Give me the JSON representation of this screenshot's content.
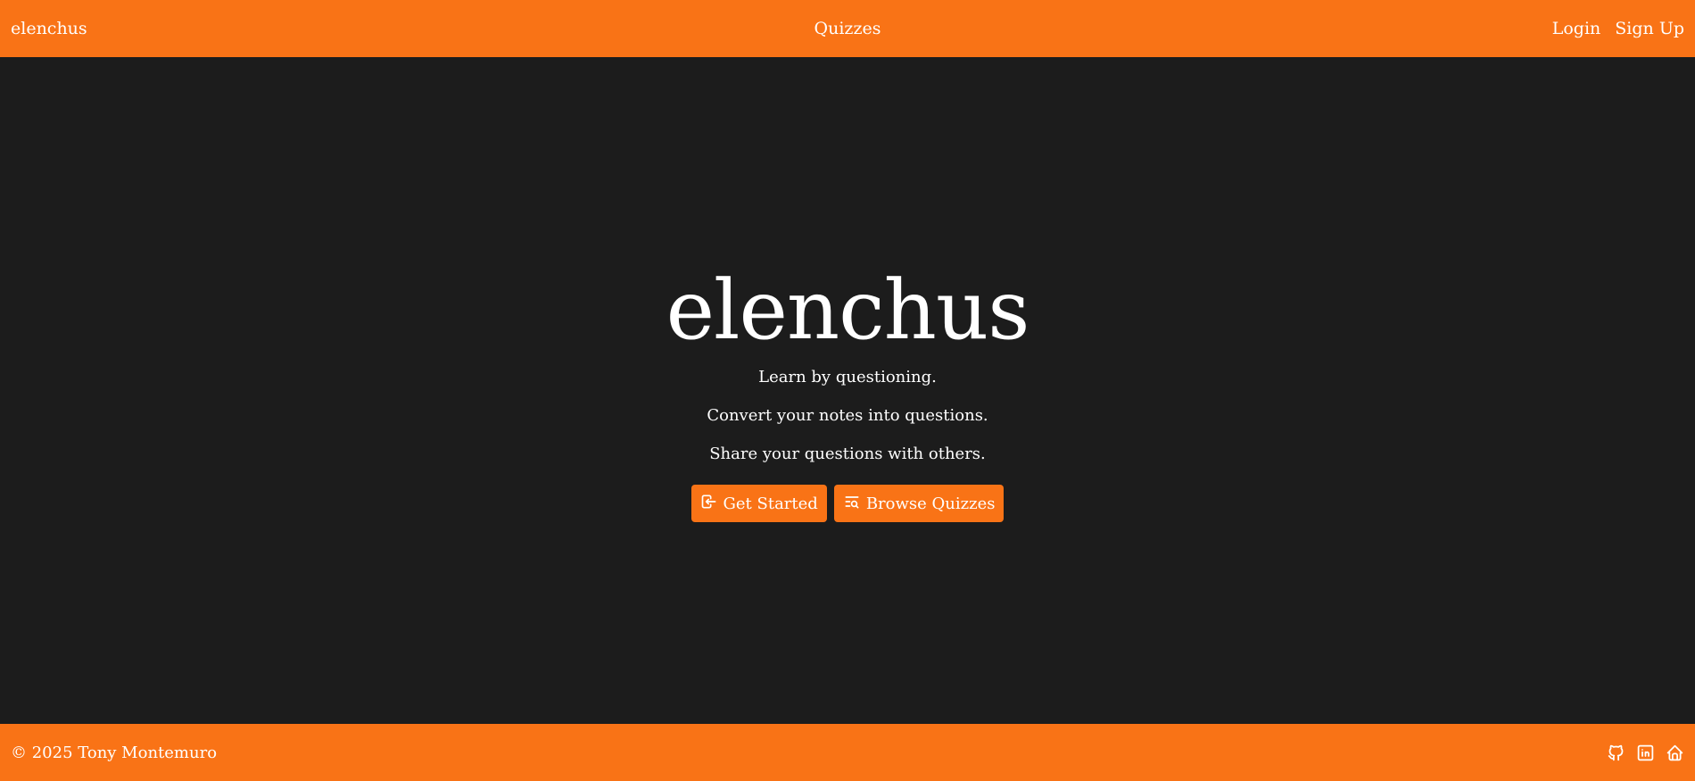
{
  "header": {
    "brand": "elenchus",
    "center_link": "Quizzes",
    "login": "Login",
    "signup": "Sign Up"
  },
  "hero": {
    "title": "elenchus",
    "tagline": "Learn by questioning.",
    "line1": "Convert your notes into questions.",
    "line2": "Share your questions with others."
  },
  "actions": {
    "get_started": {
      "label": "Get Started",
      "icon": "login-icon"
    },
    "browse": {
      "label": "Browse Quizzes",
      "icon": "list-search-icon"
    }
  },
  "footer": {
    "copyright": "© 2025 Tony Montemuro",
    "icons": [
      "github-icon",
      "linkedin-icon",
      "home-icon"
    ]
  },
  "colors": {
    "accent": "#f97316",
    "background": "#1c1c1c",
    "text": "#ffffff"
  }
}
